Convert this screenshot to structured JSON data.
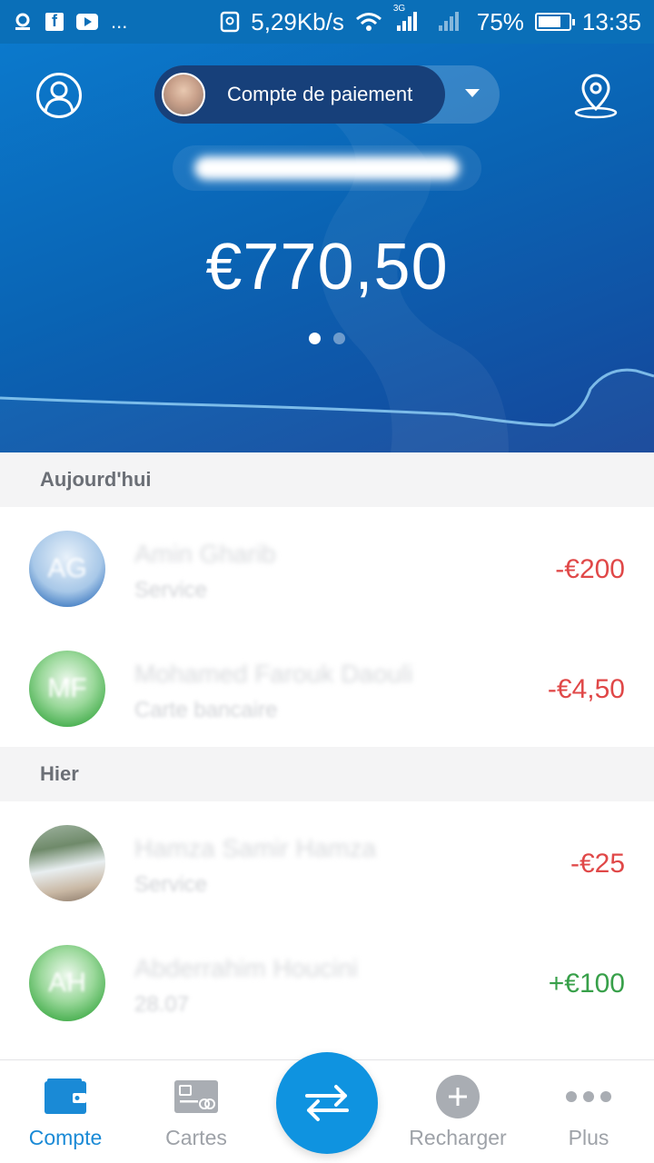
{
  "status_bar": {
    "net_speed": "5,29Kb/s",
    "network_type": "3G",
    "battery_percent": "75%",
    "battery_level": 0.75,
    "time": "13:35",
    "more": "..."
  },
  "header": {
    "account_name": "Compte de paiement",
    "balance": "€770,50",
    "page_count": 2,
    "active_page": 1
  },
  "sections": [
    {
      "label": "Aujourd'hui",
      "transactions": [
        {
          "initials": "AG",
          "name": "Amin Gharib",
          "subtitle": "Service",
          "amount": "-€200",
          "type": "debit"
        },
        {
          "initials": "MF",
          "name": "Mohamed Farouk Daouli",
          "subtitle": "Carte bancaire",
          "amount": "-€4,50",
          "type": "debit"
        }
      ]
    },
    {
      "label": "Hier",
      "transactions": [
        {
          "initials": "",
          "name": "Hamza Samir Hamza",
          "subtitle": "Service",
          "amount": "-€25",
          "type": "debit"
        },
        {
          "initials": "AH",
          "name": "Abderrahim Houcini",
          "subtitle": "28.07",
          "amount": "+€100",
          "type": "credit"
        }
      ]
    }
  ],
  "bottom_nav": {
    "compte": "Compte",
    "cartes": "Cartes",
    "recharger": "Recharger",
    "plus": "Plus"
  },
  "colors": {
    "accent": "#1a8ad6",
    "header_dark": "#15469a",
    "negative": "#e04848",
    "positive": "#38a04a"
  }
}
